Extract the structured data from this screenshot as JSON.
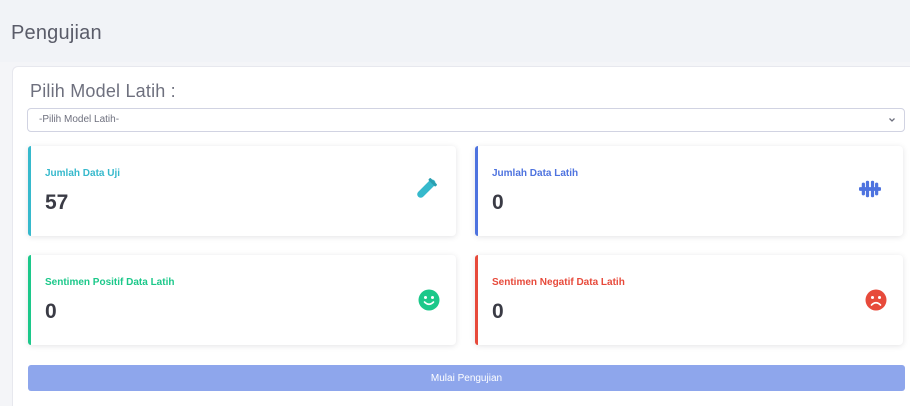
{
  "header": {
    "title": "Pengujian"
  },
  "form": {
    "label": "Pilih Model Latih :",
    "select_value": "-Pilih Model Latih-"
  },
  "stats": [
    {
      "label": "Jumlah Data Uji",
      "value": "57",
      "color": "#36b9cc",
      "icon": "vial-icon"
    },
    {
      "label": "Jumlah Data Latih",
      "value": "0",
      "color": "#4e73df",
      "icon": "dumbbell-icon"
    },
    {
      "label": "Sentimen Positif Data Latih",
      "value": "0",
      "color": "#1cc88a",
      "icon": "smile-icon"
    },
    {
      "label": "Sentimen Negatif Data Latih",
      "value": "0",
      "color": "#e74a3b",
      "icon": "frown-icon"
    }
  ],
  "actions": {
    "submit_label": "Mulai Pengujian"
  }
}
